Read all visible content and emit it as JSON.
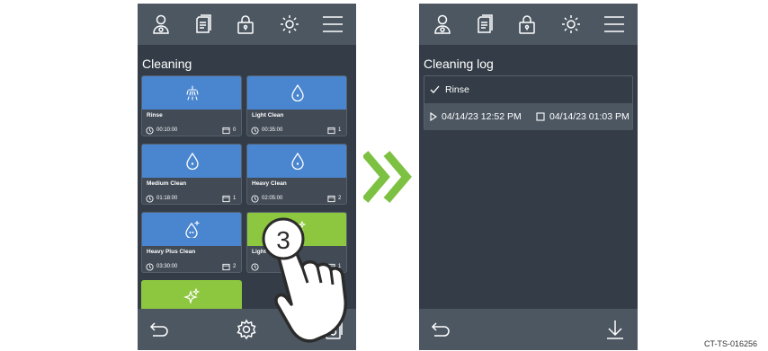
{
  "left_screen": {
    "section_title": "Cleaning",
    "top_icons": [
      "user-icon",
      "document-icon",
      "lock-icon",
      "brightness-icon",
      "menu-icon"
    ],
    "tiles": [
      {
        "name": "Rinse",
        "time": "00:10:00",
        "count": "0",
        "color": "#4a86cf",
        "icon": "shower-icon"
      },
      {
        "name": "Light Clean",
        "time": "00:35:00",
        "count": "1",
        "color": "#4a86cf",
        "icon": "drop-icon"
      },
      {
        "name": "Medium Clean",
        "time": "01:18:00",
        "count": "1",
        "color": "#4a86cf",
        "icon": "drop-icon"
      },
      {
        "name": "Heavy Clean",
        "time": "02:05:00",
        "count": "2",
        "color": "#4a86cf",
        "icon": "drop-icon"
      },
      {
        "name": "Heavy Plus Clean",
        "time": "03:30:00",
        "count": "2",
        "color": "#4a86cf",
        "icon": "drop-plus-icon"
      },
      {
        "name": "Light D",
        "time": "",
        "count": "1",
        "color": "#8dc63f",
        "icon": "sparkle-icon"
      },
      {
        "name": "",
        "time": "",
        "count": "",
        "color": "#8dc63f",
        "icon": "sparkle-icon"
      }
    ],
    "bottom_icons": [
      "back-icon",
      "settings-icon",
      "clean-log-icon"
    ]
  },
  "right_screen": {
    "section_title": "Cleaning log",
    "top_icons": [
      "user-icon",
      "document-icon",
      "lock-icon",
      "brightness-icon",
      "menu-icon"
    ],
    "log": {
      "program": "Rinse",
      "start": "04/14/23 12:52 PM",
      "end": "04/14/23 01:03 PM"
    },
    "bottom_icons": [
      "back-icon",
      "download-icon"
    ]
  },
  "step_number": "3",
  "reference_code": "CT-TS-016256",
  "colors": {
    "screen_bg": "#343d47",
    "bar_bg": "#4d5762",
    "tile_blue": "#4a86cf",
    "tile_green": "#8dc63f",
    "arrow_green": "#7cc142"
  }
}
